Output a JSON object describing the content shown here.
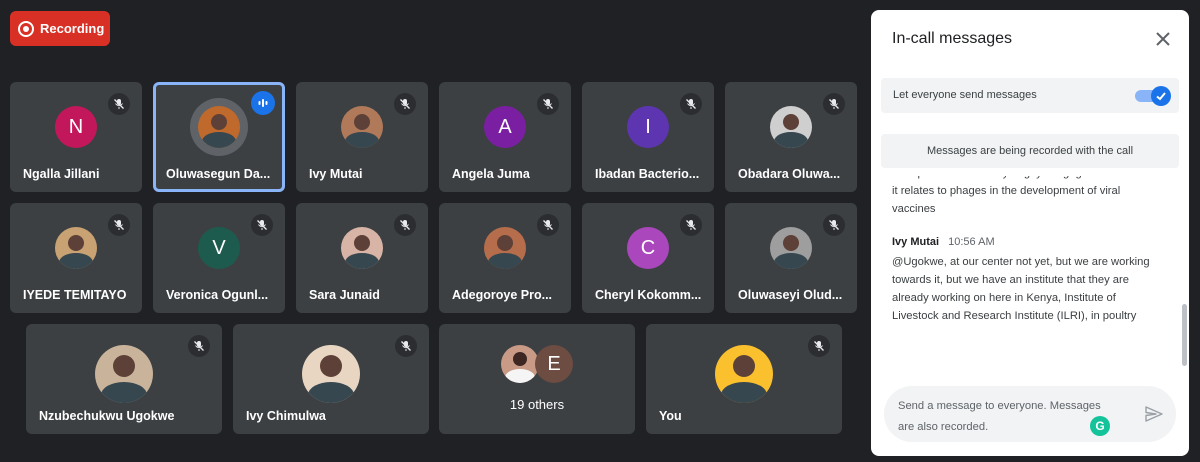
{
  "recording": {
    "label": "Recording"
  },
  "colors": {
    "recording": "#d93025",
    "tile": "#3c4043",
    "active_border": "#8ab4f8",
    "speaking": "#1a73e8",
    "background": "#202124"
  },
  "participants": [
    {
      "name": "Ngalla Jillani",
      "initial": "N",
      "avatar_color": "#c2185b",
      "muted": true
    },
    {
      "name": "Oluwasegun Da...",
      "initial": "",
      "avatar_color": "#bf6a2c",
      "speaking": true,
      "photo": true
    },
    {
      "name": "Ivy Mutai",
      "initial": "",
      "avatar_color": "#b07a5a",
      "muted": true,
      "photo": true
    },
    {
      "name": "Angela Juma",
      "initial": "A",
      "avatar_color": "#7b1fa2",
      "muted": true
    },
    {
      "name": "Ibadan Bacterio...",
      "initial": "I",
      "avatar_color": "#5e35b1",
      "muted": true
    },
    {
      "name": "Obadara Oluwa...",
      "initial": "",
      "avatar_color": "#cfcfcf",
      "muted": true,
      "photo": true
    },
    {
      "name": "IYEDE TEMITAYO",
      "initial": "",
      "avatar_color": "#c9a273",
      "muted": true,
      "photo": true
    },
    {
      "name": "Veronica Ogunl...",
      "initial": "V",
      "avatar_color": "#1e5b4f",
      "muted": true
    },
    {
      "name": "Sara Junaid",
      "initial": "",
      "avatar_color": "#d8b4a6",
      "muted": true,
      "photo": true
    },
    {
      "name": "Adegoroye Pro...",
      "initial": "",
      "avatar_color": "#b56d4c",
      "muted": true,
      "photo": true
    },
    {
      "name": "Cheryl Kokomm...",
      "initial": "C",
      "avatar_color": "#ab47bc",
      "muted": true
    },
    {
      "name": "Oluwaseyi Olud...",
      "initial": "",
      "avatar_color": "#9e9e9e",
      "muted": true,
      "photo": true
    },
    {
      "name": "Nzubechukwu Ugokwe",
      "initial": "",
      "avatar_color": "#c9b49b",
      "muted": true,
      "photo": true
    },
    {
      "name": "Ivy Chimulwa",
      "initial": "",
      "avatar_color": "#e8d6c2",
      "muted": true,
      "photo": true
    },
    {
      "name": "19 others",
      "initial": "E",
      "avatar_color": "#6d4c41"
    },
    {
      "name": "You",
      "initial": "",
      "avatar_color": "#fbc02d",
      "muted": true,
      "photo": true
    }
  ],
  "chat": {
    "title": "In-call messages",
    "toggle_label": "Let everyone send messages",
    "toggle_on": true,
    "notice": "Messages are being recorded with the call",
    "messages": [
      {
        "sender": "",
        "time": "",
        "text": "Nice presentation. Do you guys engage in research as it relates to phages in the development of viral vaccines"
      },
      {
        "sender": "Ivy Mutai",
        "time": "10:56 AM",
        "text": "@Ugokwe, at our center not yet, but we are  working towards it, but we have an institute that they are already working on here in Kenya, Institute of Livestock and Research Institute (ILRI), in poultry"
      }
    ],
    "input_placeholder": "Send a message to everyone. Messages are also recorded.",
    "grammarly_letter": "G"
  }
}
